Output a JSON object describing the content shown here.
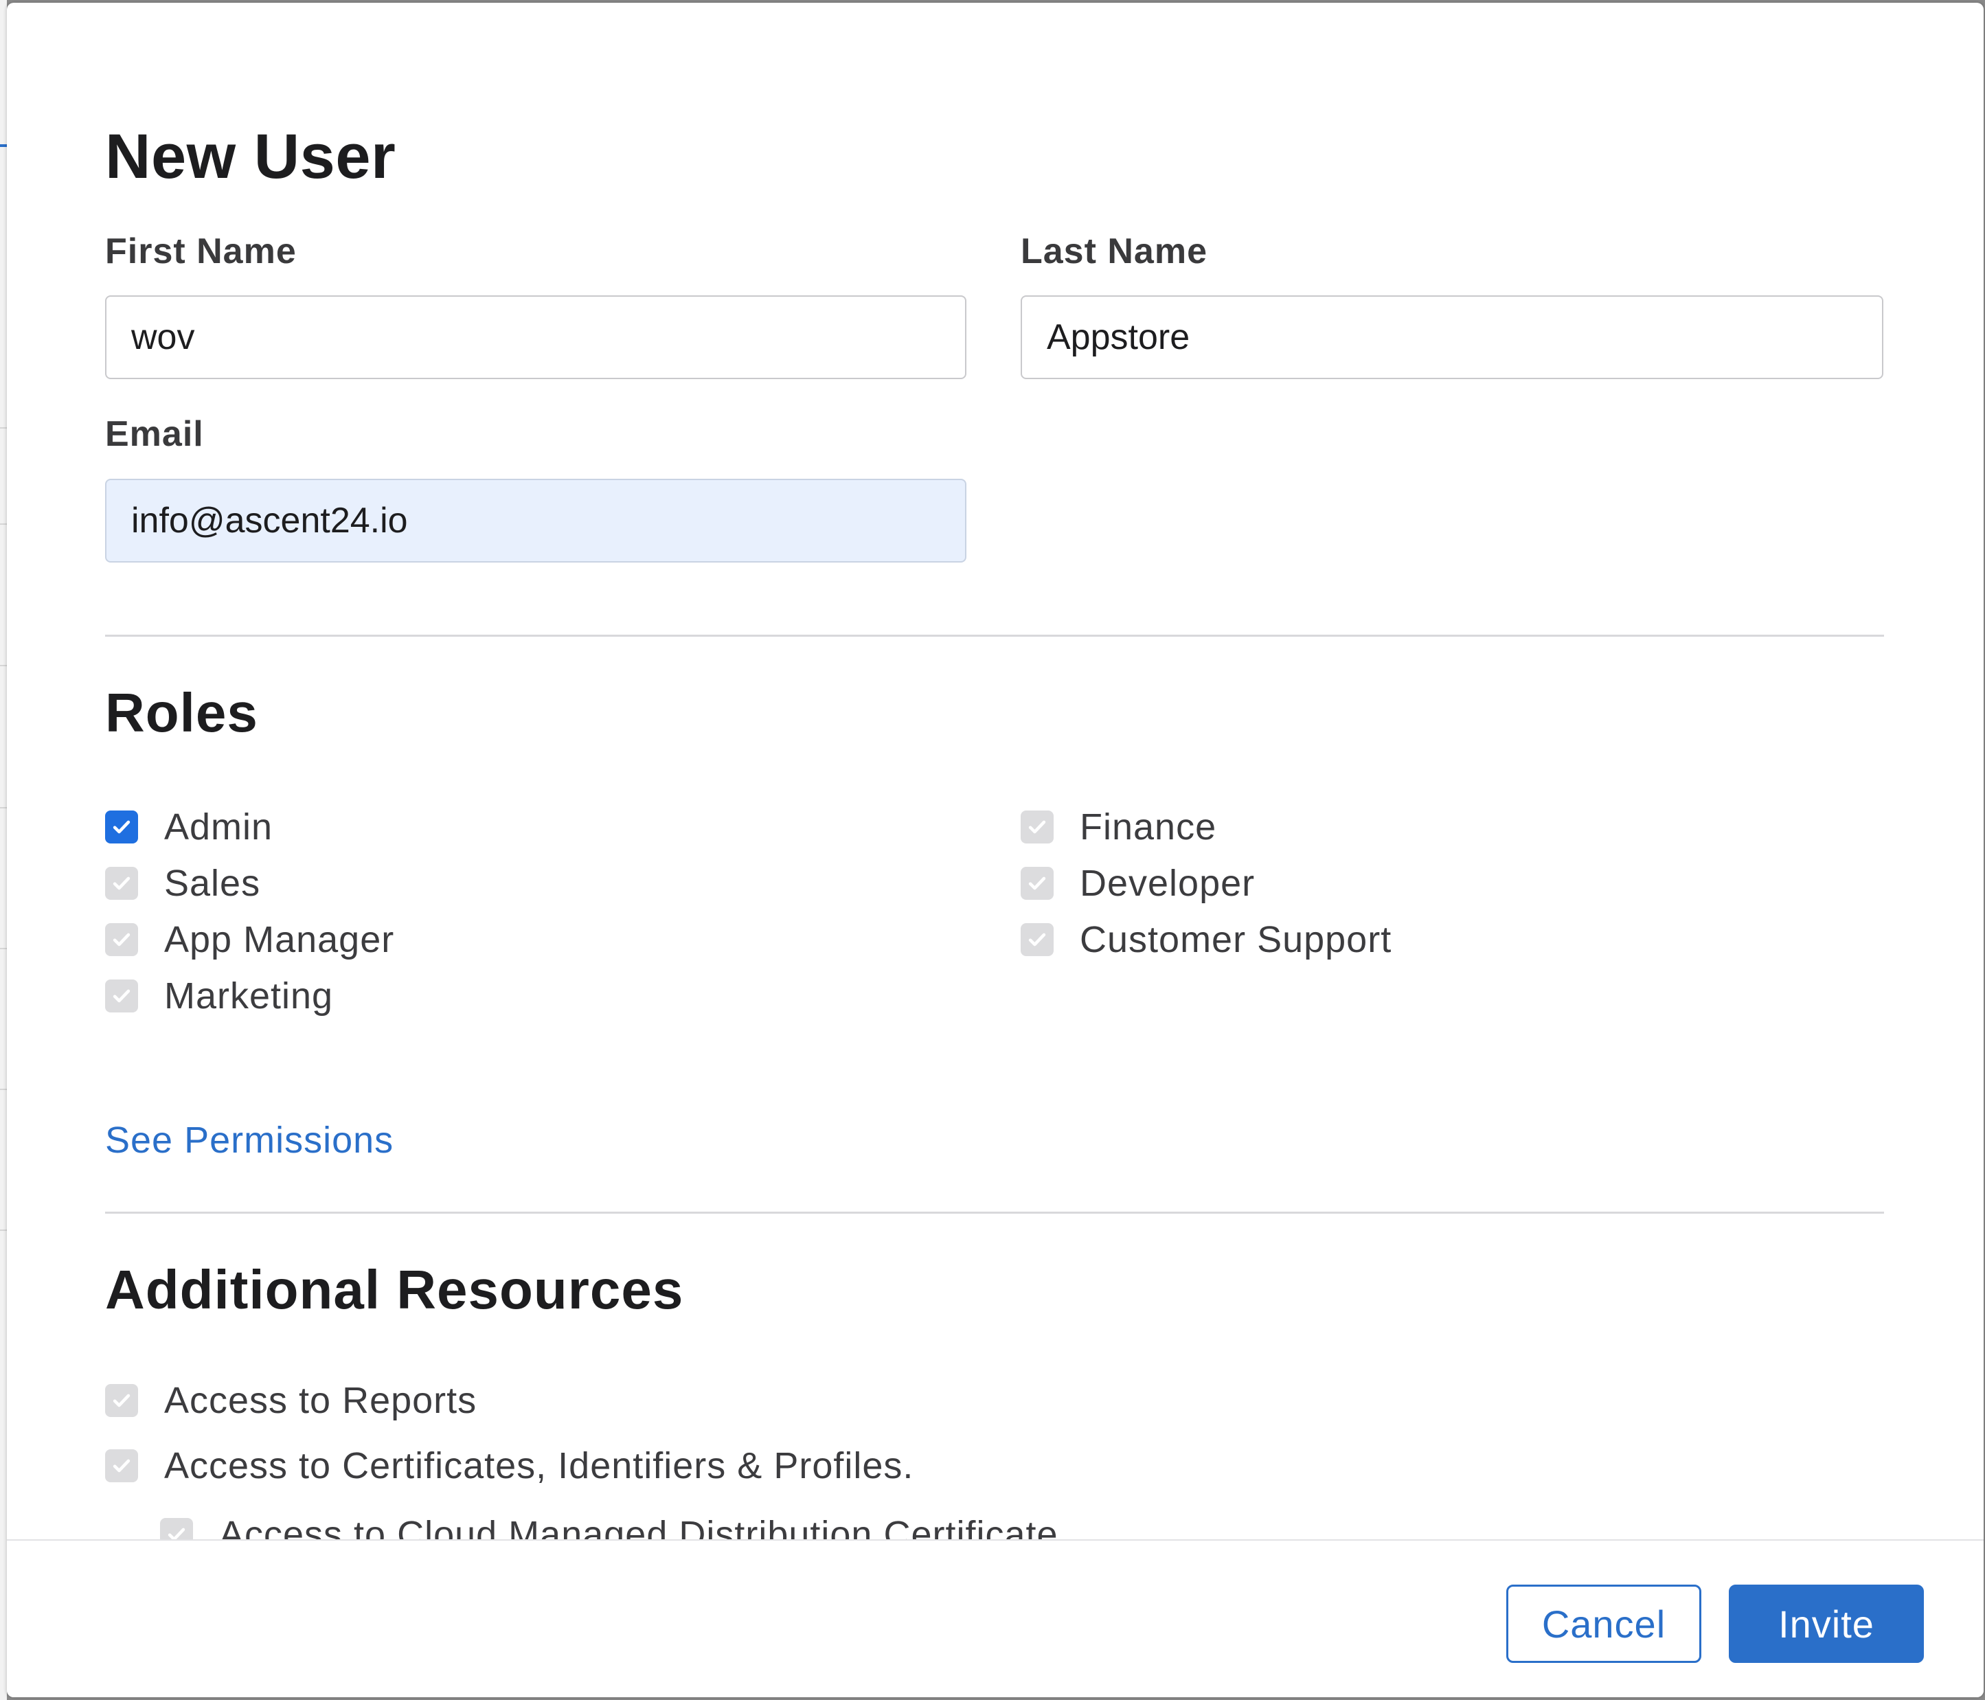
{
  "dialog": {
    "title": "New User"
  },
  "form": {
    "first_name": {
      "label": "First Name",
      "value": "wov"
    },
    "last_name": {
      "label": "Last Name",
      "value": "Appstore"
    },
    "email": {
      "label": "Email",
      "value": "info@ascent24.io"
    }
  },
  "roles": {
    "title": "Roles",
    "items": [
      {
        "label": "Admin",
        "checked": true,
        "enabled": true
      },
      {
        "label": "Sales",
        "checked": true,
        "enabled": false
      },
      {
        "label": "App Manager",
        "checked": true,
        "enabled": false
      },
      {
        "label": "Marketing",
        "checked": true,
        "enabled": false
      },
      {
        "label": "Finance",
        "checked": true,
        "enabled": false
      },
      {
        "label": "Developer",
        "checked": true,
        "enabled": false
      },
      {
        "label": "Customer Support",
        "checked": true,
        "enabled": false
      }
    ],
    "see_permissions_link": "See Permissions"
  },
  "additional_resources": {
    "title": "Additional Resources",
    "items": [
      {
        "label": "Access to Reports",
        "checked": true,
        "enabled": false
      },
      {
        "label": "Access to Certificates, Identifiers & Profiles.",
        "checked": true,
        "enabled": false
      },
      {
        "label": "Access to Cloud Managed Distribution Certificate",
        "checked": true,
        "enabled": false
      }
    ]
  },
  "footer": {
    "cancel_label": "Cancel",
    "invite_label": "Invite"
  },
  "colors": {
    "accent": "#2a6fc9",
    "checkbox_checked": "#1f6fe0",
    "checkbox_disabled": "#dcdcde",
    "autofill_bg": "#e8f0fd"
  },
  "icons": {
    "checkmark": "checkmark-icon"
  }
}
